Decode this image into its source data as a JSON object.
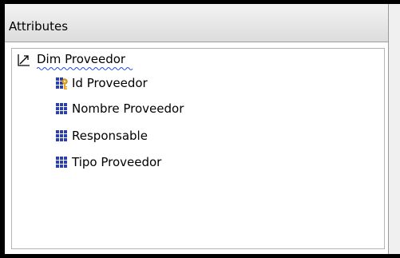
{
  "panel": {
    "title": "Attributes"
  },
  "tree": {
    "root": {
      "label": "Dim Proveedor",
      "icon": "hierarchy-icon"
    },
    "items": [
      {
        "label": "Id Proveedor",
        "icon": "key-attribute-icon"
      },
      {
        "label": "Nombre Proveedor",
        "icon": "attribute-icon"
      },
      {
        "label": "Responsable",
        "icon": "attribute-icon"
      },
      {
        "label": "Tipo Proveedor",
        "icon": "attribute-icon"
      }
    ]
  },
  "colors": {
    "attribute_icon": "#2b3fae",
    "key_icon": "#e8a623",
    "squiggle": "#2b50d8"
  }
}
